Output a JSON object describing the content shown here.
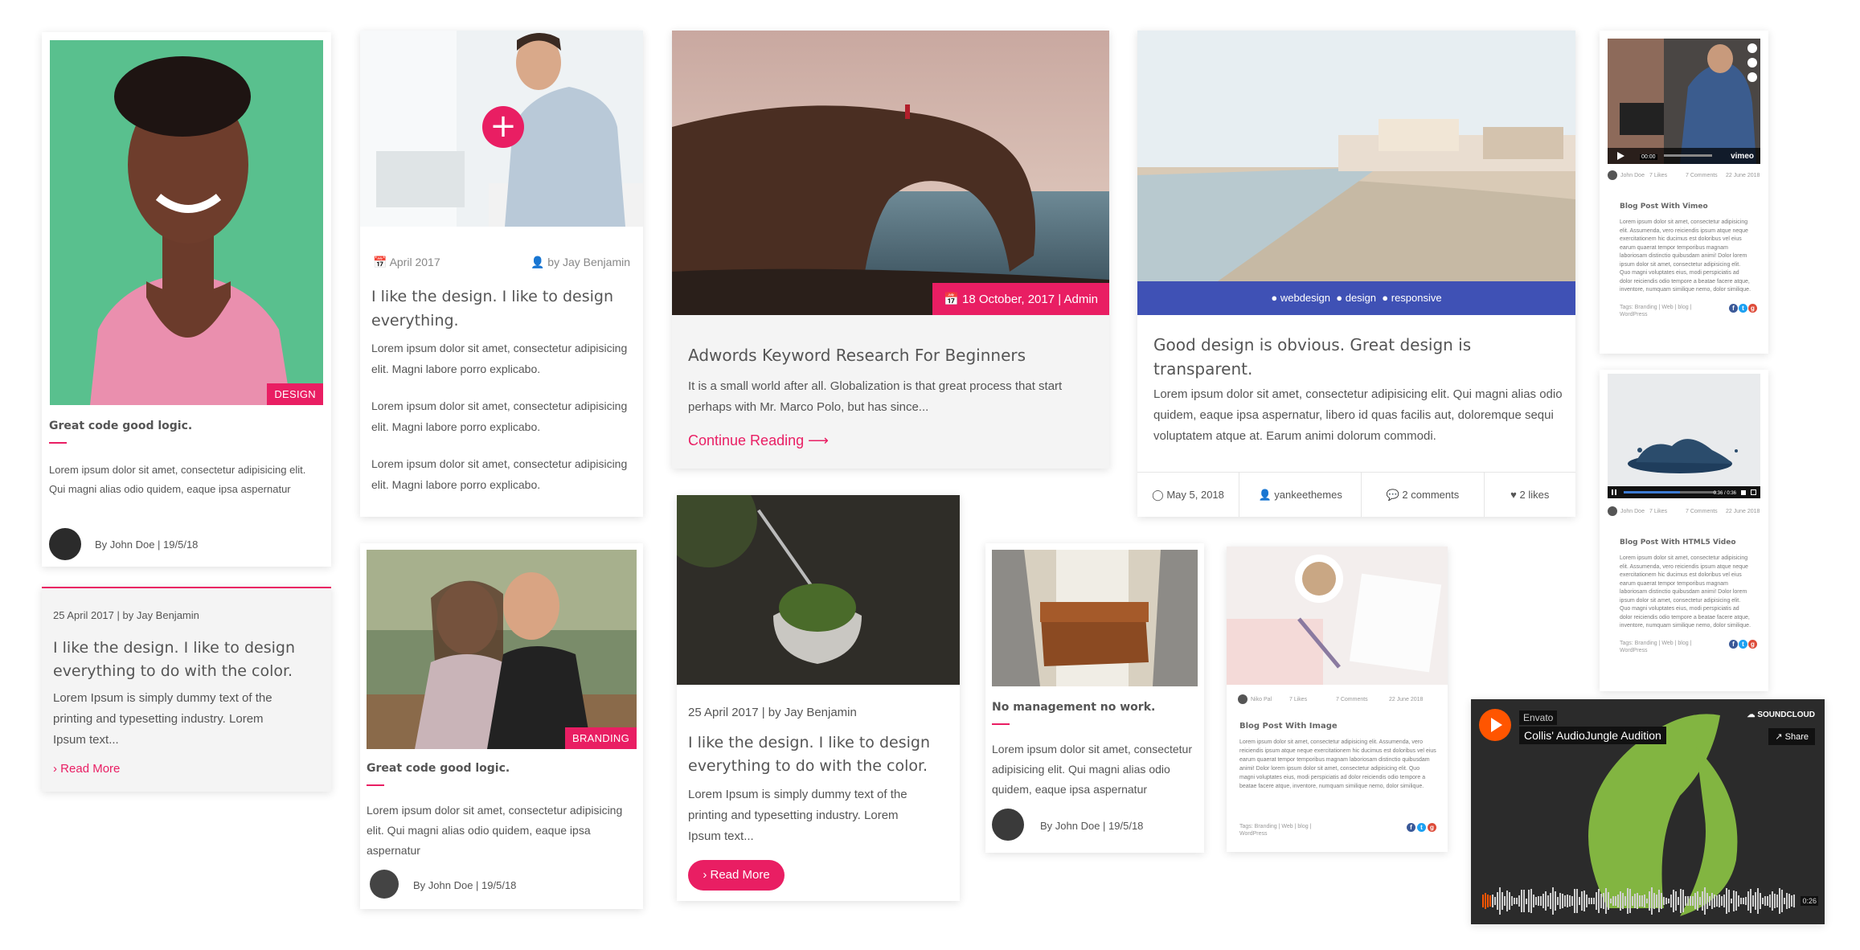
{
  "c1": {
    "tag": "DESIGN",
    "title": "Great code good logic.",
    "text": "Lorem ipsum dolor sit amet, consectetur adipisicing elit. Qui magni alias odio quidem, eaque ipsa aspernatur",
    "author": "By John Doe | 19/5/18"
  },
  "c2": {
    "date": "April 2017",
    "author": "by Jay Benjamin",
    "title": "I like the design. I like to design everything.",
    "paras": [
      "Lorem ipsum dolor sit amet, consectetur adipisicing elit. Magni labore porro explicabo.",
      "Lorem ipsum dolor sit amet, consectetur adipisicing elit. Magni labore porro explicabo.",
      "Lorem ipsum dolor sit amet, consectetur adipisicing elit. Magni labore porro explicabo."
    ]
  },
  "c3": {
    "badge": "18 October, 2017 | Admin",
    "title": "Adwords Keyword Research For Beginners",
    "text": "It is a small world after all. Globalization is that great process that start perhaps with Mr. Marco Polo, but has since...",
    "link": "Continue Reading ⟶"
  },
  "c4": {
    "tags": [
      "webdesign",
      "design",
      "responsive"
    ],
    "title": "Good design is obvious. Great design is transparent.",
    "text": "Lorem ipsum dolor sit amet, consectetur adipisicing elit. Qui magni alias odio quidem, eaque ipsa aspernatur, libero id quas facilis aut, doloremque sequi voluptatem atque at. Earum animi dolorum commodi.",
    "footer": [
      "May 5, 2018",
      "yankeethemes",
      "2 comments",
      "2 likes"
    ]
  },
  "c5": {
    "meta": [
      "John Doe",
      "7 Likes",
      "7 Comments",
      "22 June 2018"
    ],
    "title": "Blog Post With Vimeo",
    "text": "Lorem ipsum dolor sit amet, consectetur adipisicing elit. Assumenda, vero reiciendis ipsum atque neque exercitationem hic ducimus est doloribus vel eius earum quaerat tempor temporibus magnam laboriosam distinctio quibusdam animi! Dolor lorem ipsum dolor sit amet, consectetur adipisicing elit. Quo magni voluptates eius, modi perspiciatis ad dolor reiciendis odio tempore a beatae facere atque, inventore, numquam similique nemo, dolor similique.",
    "tags": "Tags: Branding | Web | blog | WordPress",
    "player_logo": "vimeo",
    "player_time": "00:00"
  },
  "c6": {
    "meta": [
      "John Doe",
      "7 Likes",
      "7 Comments",
      "22 June 2018"
    ],
    "title": "Blog Post With HTML5 Video",
    "text": "Lorem ipsum dolor sit amet, consectetur adipisicing elit. Assumenda, vero reiciendis ipsum atque neque exercitationem hic ducimus est doloribus vel eius earum quaerat tempor temporibus magnam laboriosam distinctio quibusdam animi! Dolor lorem ipsum dolor sit amet, consectetur adipisicing elit. Quo magni voluptates eius, modi perspiciatis ad dolor reiciendis odio tempore a beatae facere atque, inventore, numquam similique nemo, dolor similique.",
    "tags": "Tags: Branding | Web | blog | WordPress",
    "player_time": "0:36 / 0:36"
  },
  "c7": {
    "meta": "25 April 2017 | by Jay Benjamin",
    "title": "I like the design. I like to design everything to do with the color.",
    "text": "Lorem Ipsum is simply dummy text of the printing and typesetting industry. Lorem Ipsum text...",
    "link": "Read More"
  },
  "c8": {
    "tag": "BRANDING",
    "title": "Great code good logic.",
    "text": "Lorem ipsum dolor sit amet, consectetur adipisicing elit. Qui magni alias odio quidem, eaque ipsa aspernatur",
    "author": "By John Doe | 19/5/18"
  },
  "c9": {
    "meta": "25 April 2017 | by Jay Benjamin",
    "title": "I like the design. I like to design everything to do with the color.",
    "text": "Lorem Ipsum is simply dummy text of the printing and typesetting industry. Lorem Ipsum text...",
    "button": "Read More"
  },
  "c10": {
    "title": "No management no work.",
    "text": "Lorem ipsum dolor sit amet, consectetur adipisicing elit. Qui magni alias odio quidem, eaque ipsa aspernatur",
    "author": "By John Doe | 19/5/18"
  },
  "c11": {
    "meta": [
      "Niko Pal",
      "7 Likes",
      "7 Comments",
      "22 June 2018"
    ],
    "title": "Blog Post With Image",
    "text": "Lorem ipsum dolor sit amet, consectetur adipisicing elit. Assumenda, vero reiciendis ipsum atque neque exercitationem hic ducimus est doloribus vel eius earum quaerat tempor temporibus magnam laboriosam distinctio quibusdam animi! Dolor lorem ipsum dolor sit amet, consectetur adipisicing elit. Quo magni voluptates eius, modi perspiciatis ad dolor reiciendis odio tempore a beatae facere atque, inventore, numquam similique nemo, dolor similique.",
    "tags": "Tags: Branding | Web | blog | WordPress"
  },
  "c12": {
    "user": "Envato",
    "track": "Collis' AudioJungle Audition",
    "brand": "SOUNDCLOUD",
    "share": "Share",
    "time": "0:26"
  },
  "colors": {
    "accent": "#e91e63",
    "tagbar": "#3f51b5",
    "sc_orange": "#ff5500"
  }
}
